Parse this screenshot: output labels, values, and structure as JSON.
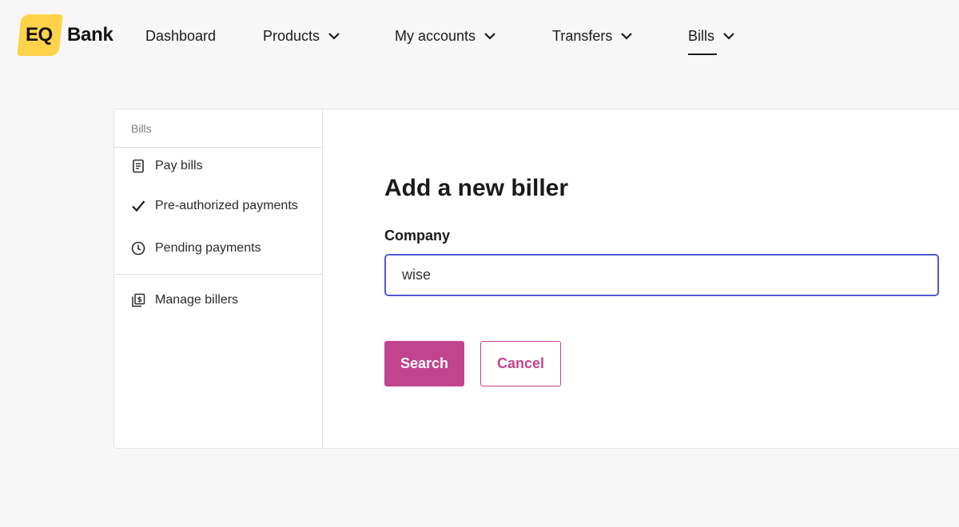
{
  "brand": {
    "mark": "EQ",
    "name": "Bank"
  },
  "nav": {
    "dashboard": "Dashboard",
    "products": "Products",
    "my_accounts": "My accounts",
    "transfers": "Transfers",
    "bills": "Bills"
  },
  "sidebar": {
    "header": "Bills",
    "items": [
      {
        "label": "Pay bills",
        "icon": "receipt-icon"
      },
      {
        "label": "Pre-authorized payments",
        "icon": "check-icon"
      },
      {
        "label": "Pending payments",
        "icon": "clock-icon"
      },
      {
        "label": "Manage billers",
        "icon": "biller-stack-icon"
      }
    ]
  },
  "form": {
    "title": "Add a new biller",
    "company_label": "Company",
    "company_value": "wise",
    "search_label": "Search",
    "cancel_label": "Cancel"
  },
  "colors": {
    "accent": "#c2448e",
    "brand_yellow": "#ffd24a",
    "focus_border": "#5058d6"
  }
}
